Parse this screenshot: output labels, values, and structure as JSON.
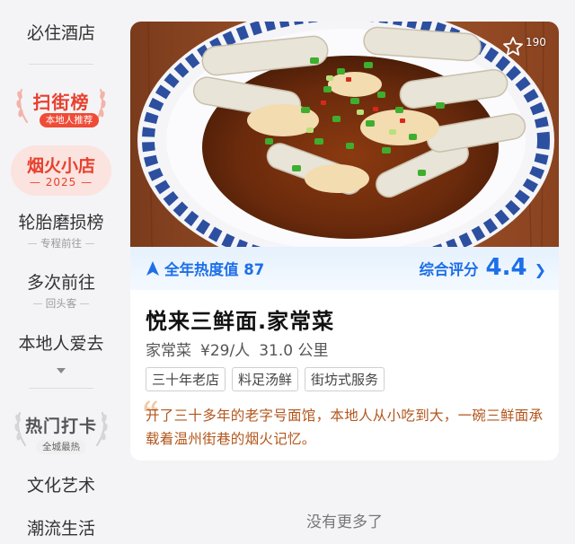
{
  "sidebar": {
    "items": [
      {
        "label": "必住酒店"
      },
      {
        "label": "扫街榜",
        "sub": "本地人推荐"
      },
      {
        "label": "烟火小店",
        "sub": "2025"
      },
      {
        "label": "轮胎磨损榜",
        "sub": "专程前往"
      },
      {
        "label": "多次前往",
        "sub": "回头客"
      },
      {
        "label": "本地人爱去"
      },
      {
        "label": "热门打卡",
        "sub": "全城最热"
      },
      {
        "label": "文化艺术"
      },
      {
        "label": "潮流生活"
      }
    ],
    "selected_index": 2,
    "accent_color": "#e8402e"
  },
  "card": {
    "favorite_count": "190",
    "heat_label": "全年热度值 87",
    "rating_label": "综合评分",
    "rating_value": "4.4",
    "name": "悦来三鲜面.家常菜",
    "cuisine": "家常菜",
    "price": "¥29/人",
    "distance": "31.0 公里",
    "tags": [
      "三十年老店",
      "料足汤鲜",
      "街坊式服务"
    ],
    "description": "开了三十多年的老字号面馆，本地人从小吃到大，一碗三鲜面承载着温州街巷的烟火记忆。",
    "heat_color": "#1d6fe8",
    "description_color": "#b2561b"
  },
  "footer": {
    "no_more": "没有更多了"
  }
}
